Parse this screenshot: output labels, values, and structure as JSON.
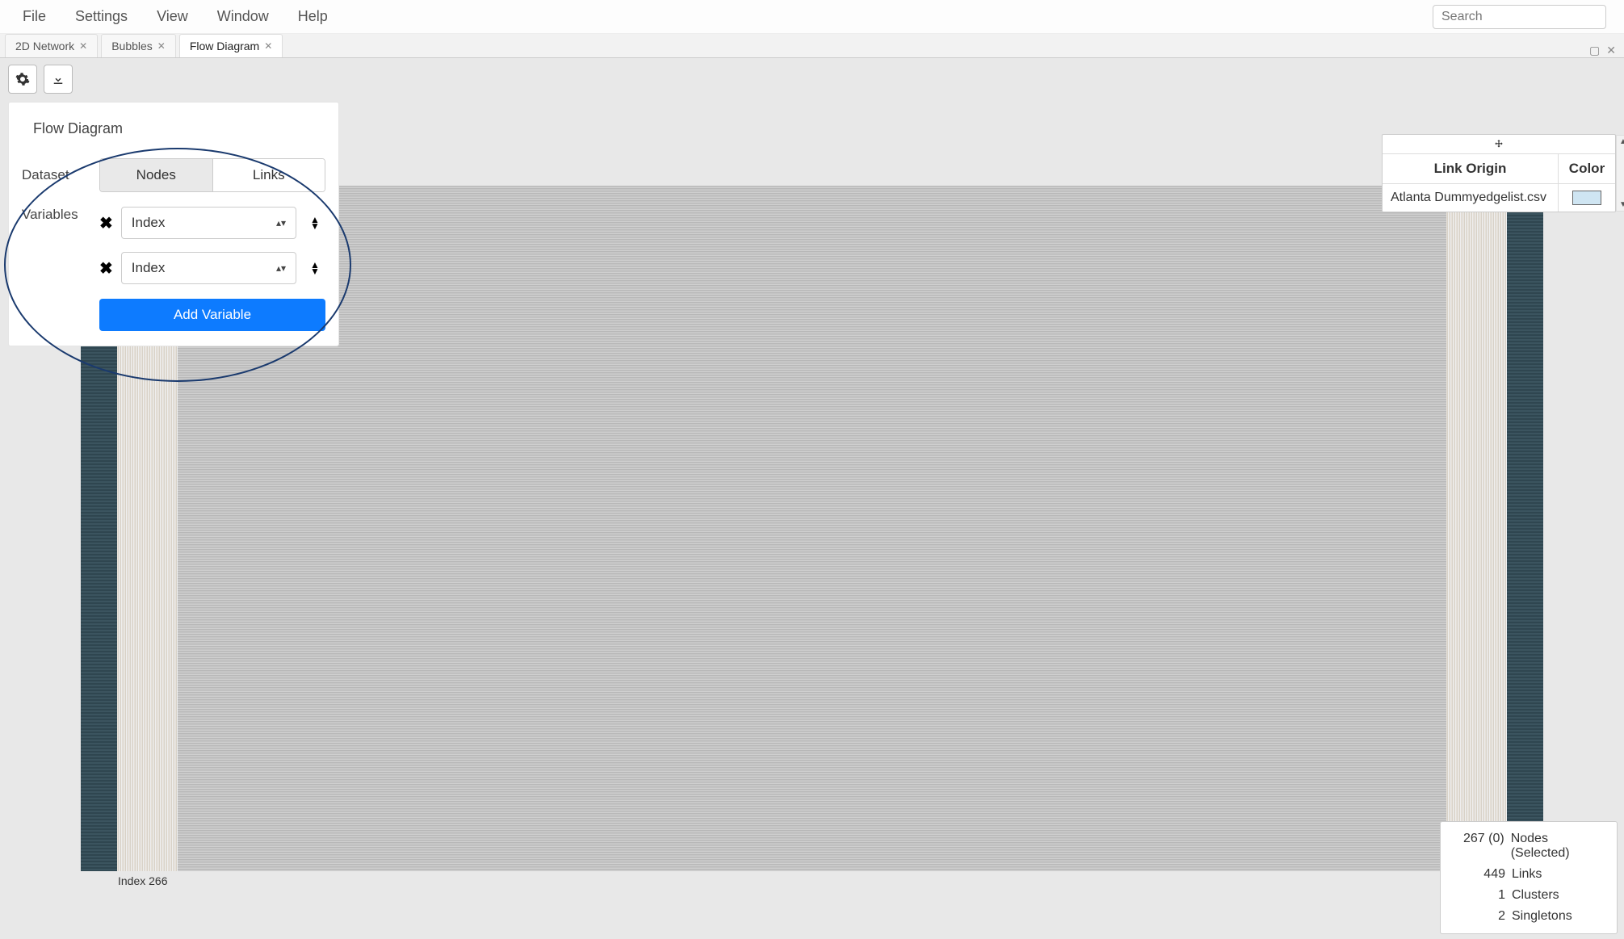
{
  "menu": {
    "items": [
      "File",
      "Settings",
      "View",
      "Window",
      "Help"
    ],
    "searchPlaceholder": "Search"
  },
  "tabs": [
    {
      "label": "2D Network",
      "active": false
    },
    {
      "label": "Bubbles",
      "active": false
    },
    {
      "label": "Flow Diagram",
      "active": true
    }
  ],
  "panel": {
    "title": "Flow Diagram",
    "rows": {
      "datasetLabel": "Dataset",
      "datasetSegments": [
        "Nodes",
        "Links"
      ],
      "datasetActive": "Nodes",
      "variablesLabel": "Variables"
    },
    "variables": [
      {
        "value": "Index"
      },
      {
        "value": "Index"
      }
    ],
    "addVarLabel": "Add Variable"
  },
  "flow": {
    "bottomLeftLabel": "Index 266"
  },
  "legend": {
    "header": {
      "origin": "Link Origin",
      "color": "Color"
    },
    "rows": [
      {
        "origin": "Atlanta Dummyedgelist.csv",
        "colorHex": "#cfe5f2"
      }
    ]
  },
  "stats": {
    "rows": [
      {
        "num": "267 (0)",
        "lbl": "Nodes (Selected)"
      },
      {
        "num": "449",
        "lbl": "Links"
      },
      {
        "num": "1",
        "lbl": "Clusters"
      },
      {
        "num": "2",
        "lbl": "Singletons"
      }
    ]
  }
}
